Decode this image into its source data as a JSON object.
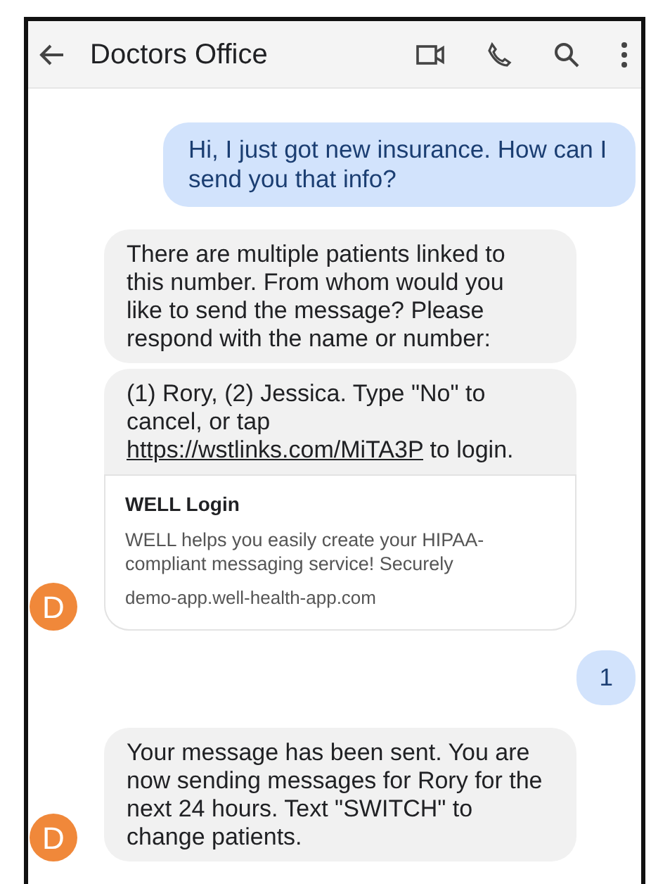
{
  "header": {
    "title": "Doctors Office"
  },
  "messages": [
    {
      "kind": "outgoing",
      "bubbles": [
        {
          "text": "Hi, I just got new insurance. How can I send you that info?"
        }
      ]
    },
    {
      "kind": "incoming",
      "avatar": "D",
      "bubbles": [
        {
          "text": "There are multiple patients linked to this number. From whom would you like to send the message?  Please respond with the name or number:"
        },
        {
          "text": "(1) Rory, (2) Jessica. Type \"No\" to cancel, or tap ",
          "link": "https://wstlinks.com/MiTA3P",
          "after": " to login.",
          "preview": {
            "title": "WELL Login",
            "description": "WELL helps you easily create your HIPAA-compliant messaging service! Securely",
            "domain": "demo-app.well-health-app.com"
          }
        }
      ]
    },
    {
      "kind": "outgoing",
      "bubbles": [
        {
          "text": "1"
        }
      ]
    },
    {
      "kind": "incoming",
      "avatar": "D",
      "bubbles": [
        {
          "text": "Your message has been sent. You are now sending messages for Rory for the next 24 hours.  Text \"SWITCH\" to change patients."
        }
      ]
    }
  ]
}
